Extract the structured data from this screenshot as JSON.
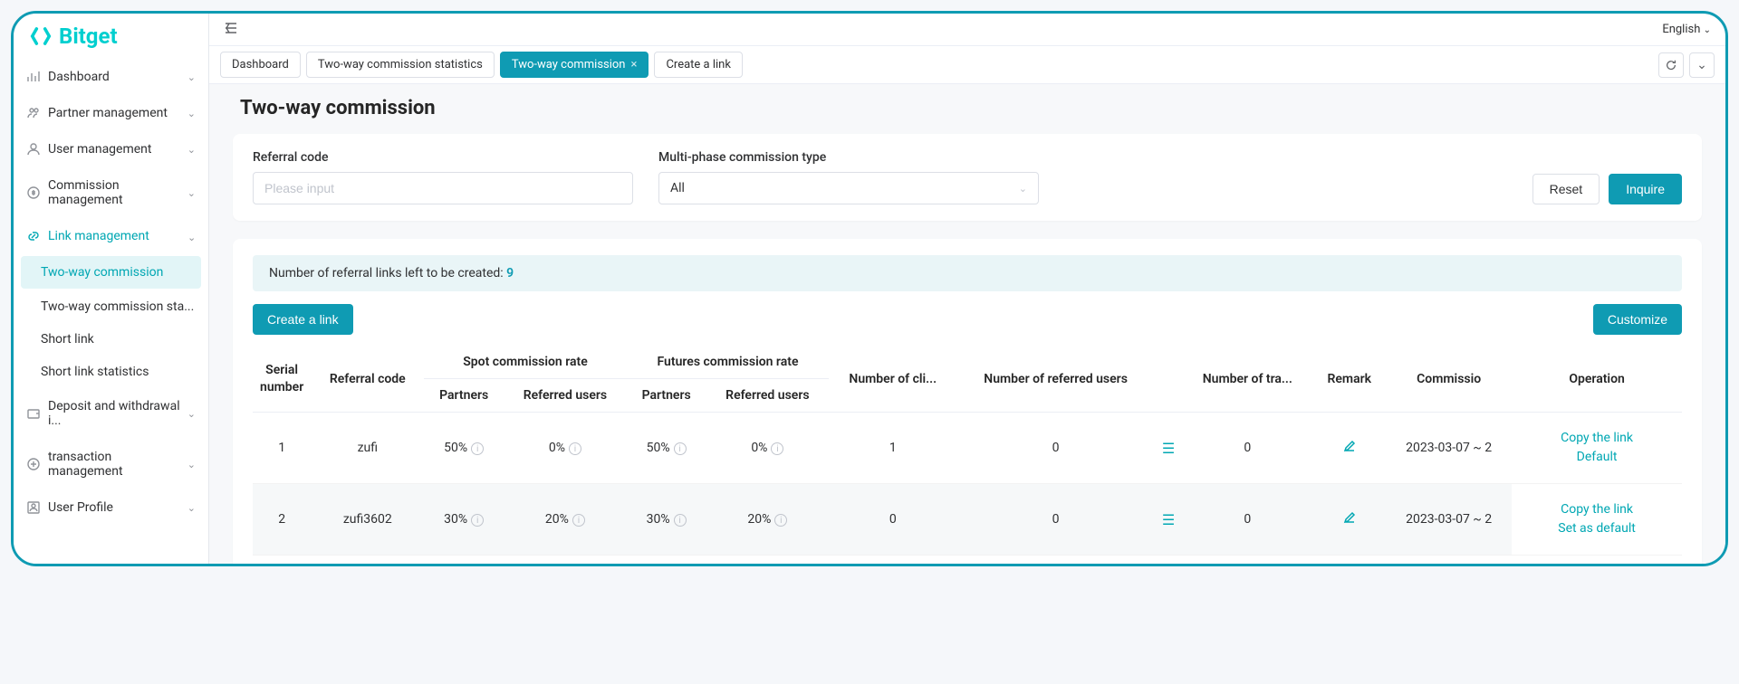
{
  "brand": "Bitget",
  "language": "English",
  "sidebar": {
    "items": [
      {
        "label": "Dashboard"
      },
      {
        "label": "Partner management"
      },
      {
        "label": "User management"
      },
      {
        "label": "Commission management"
      },
      {
        "label": "Link management",
        "active": true,
        "submenu": [
          {
            "label": "Two-way commission",
            "active": true
          },
          {
            "label": "Two-way commission sta..."
          },
          {
            "label": "Short link"
          },
          {
            "label": "Short link statistics"
          }
        ]
      },
      {
        "label": "Deposit and withdrawal i..."
      },
      {
        "label": "transaction management"
      },
      {
        "label": "User Profile"
      }
    ]
  },
  "tabs": [
    {
      "label": "Dashboard"
    },
    {
      "label": "Two-way commission statistics"
    },
    {
      "label": "Two-way commission",
      "active": true,
      "closable": true
    },
    {
      "label": "Create a link"
    }
  ],
  "page": {
    "title": "Two-way commission",
    "filters": {
      "referral_label": "Referral code",
      "referral_placeholder": "Please input",
      "multiphase_label": "Multi-phase commission type",
      "multiphase_value": "All",
      "reset": "Reset",
      "inquire": "Inquire"
    },
    "info_banner_prefix": "Number of referral links left to be created: ",
    "info_banner_count": "9",
    "create_link": "Create a link",
    "customize": "Customize",
    "columns": {
      "serial": "Serial number",
      "referral_code": "Referral code",
      "spot_group": "Spot commission rate",
      "futures_group": "Futures commission rate",
      "partners": "Partners",
      "referred_users": "Referred users",
      "num_clicks": "Number of cli...",
      "num_ref_users": "Number of referred users",
      "num_trades": "Number of tra...",
      "remark": "Remark",
      "commission": "Commissio",
      "operation": "Operation"
    },
    "rows": [
      {
        "serial": "1",
        "code": "zufi",
        "spot_partners": "50%",
        "spot_referred": "0%",
        "fut_partners": "50%",
        "fut_referred": "0%",
        "clicks": "1",
        "ref_users": "0",
        "trades": "0",
        "commission": "2023-03-07 ~ 2",
        "op1": "Copy the link",
        "op2": "Default"
      },
      {
        "serial": "2",
        "code": "zufi3602",
        "spot_partners": "30%",
        "spot_referred": "20%",
        "fut_partners": "30%",
        "fut_referred": "20%",
        "clicks": "0",
        "ref_users": "0",
        "trades": "0",
        "commission": "2023-03-07 ~ 2",
        "op1": "Copy the link",
        "op2": "Set as default"
      }
    ]
  }
}
